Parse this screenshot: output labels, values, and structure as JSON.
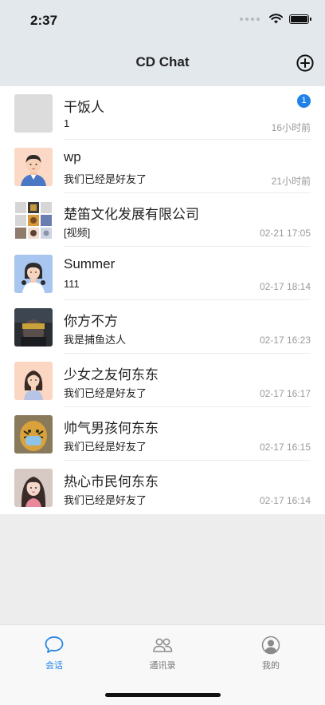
{
  "status": {
    "time": "2:37"
  },
  "header": {
    "title": "CD Chat",
    "add_icon": "plus-circle-icon"
  },
  "conversations": [
    {
      "name": "干饭人",
      "last_message": "1",
      "time": "16小时前",
      "unread": "1",
      "avatar": "gray-placeholder"
    },
    {
      "name": "wp",
      "last_message": "我们已经是好友了",
      "time": "21小时前",
      "avatar": "man-illustration"
    },
    {
      "name": "楚笛文化发展有限公司",
      "last_message": "[视频]",
      "time": "02-21 17:05",
      "avatar": "group-grid"
    },
    {
      "name": "Summer",
      "last_message": "111",
      "time": "02-17 18:14",
      "avatar": "girl-illustration-blue"
    },
    {
      "name": "你方不方",
      "last_message": "我是捕鱼达人",
      "time": "02-17 16:23",
      "avatar": "dark-photo"
    },
    {
      "name": "少女之友何东东",
      "last_message": "我们已经是好友了",
      "time": "02-17 16:17",
      "avatar": "woman-illustration-peach"
    },
    {
      "name": "帅气男孩何东东",
      "last_message": "我们已经是好友了",
      "time": "02-17 16:15",
      "avatar": "tiger-photo"
    },
    {
      "name": "热心市民何东东",
      "last_message": "我们已经是好友了",
      "time": "02-17 16:14",
      "avatar": "girl-photo"
    }
  ],
  "tabs": [
    {
      "label": "会话",
      "icon": "chat-bubble-icon",
      "active": true
    },
    {
      "label": "通讯录",
      "icon": "contacts-icon",
      "active": false
    },
    {
      "label": "我的",
      "icon": "profile-icon",
      "active": false
    }
  ],
  "colors": {
    "accent": "#1e82e8",
    "header_bg": "#e3e8ed",
    "badge": "#1e82e8"
  }
}
